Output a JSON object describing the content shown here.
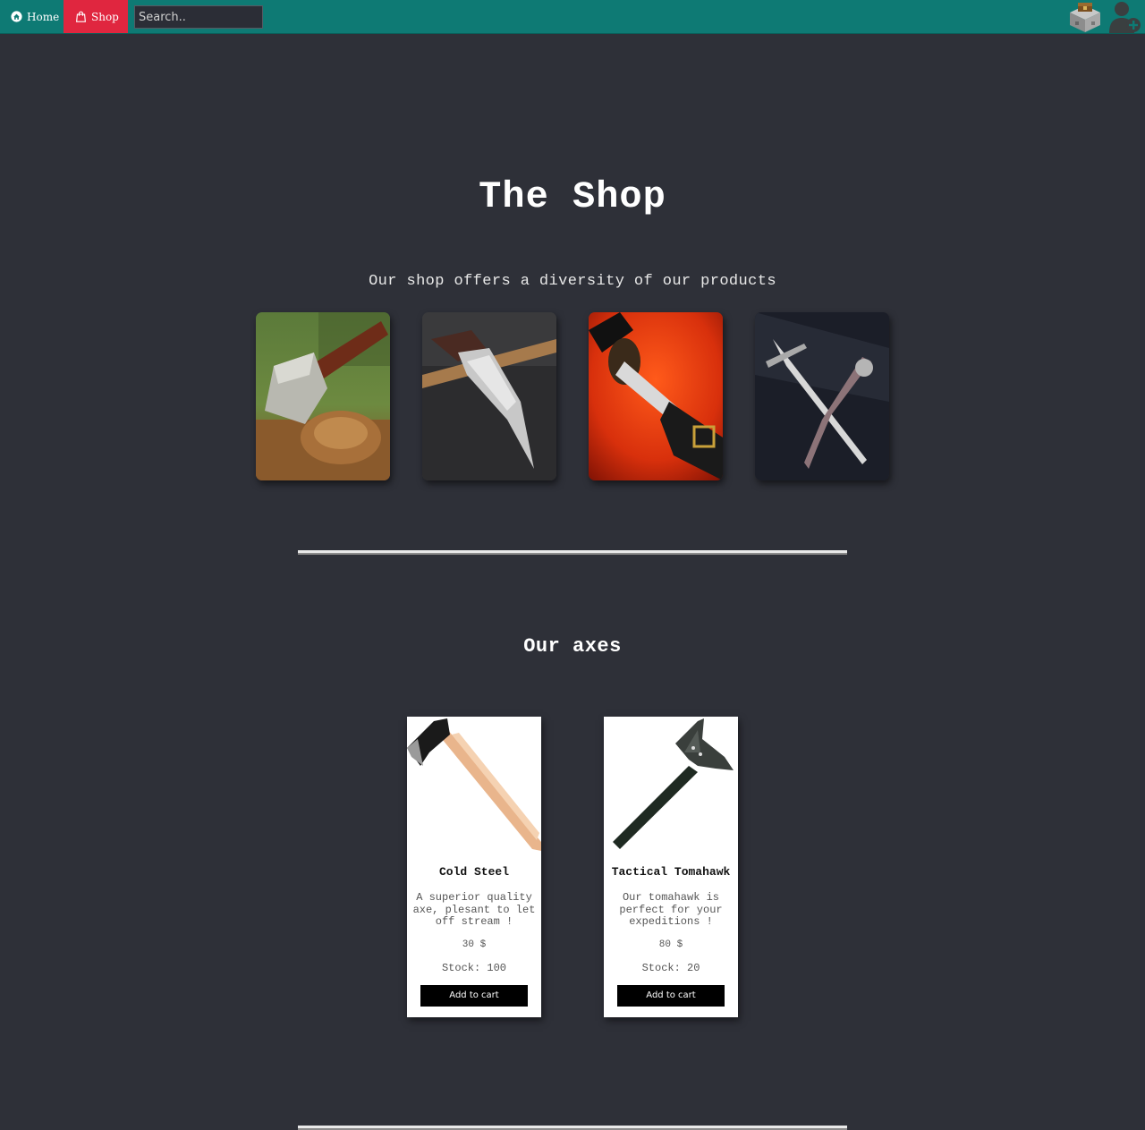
{
  "nav": {
    "home_label": "Home",
    "shop_label": "Shop",
    "search_placeholder": "Search..",
    "accent_color": "#0e7a74",
    "active_color": "#e0263f"
  },
  "header": {
    "title": "The Shop",
    "subtitle": "Our shop offers a diversity of our products"
  },
  "gallery": [
    {
      "icon": "axe-on-stump-photo"
    },
    {
      "icon": "folding-knife-photo"
    },
    {
      "icon": "katana-on-red-silk-photo"
    },
    {
      "icon": "dagger-pair-photo"
    }
  ],
  "axes_section": {
    "title": "Our axes",
    "products": [
      {
        "name": "Cold Steel",
        "description": "A superior quality axe, plesant to let off stream !",
        "price": "30 $",
        "stock": "Stock: 100",
        "button": "Add to cart",
        "icon": "felling-axe-image"
      },
      {
        "name": "Tactical Tomahawk",
        "description": "Our tomahawk is perfect for your expeditions !",
        "price": "80 $",
        "stock": "Stock: 20",
        "button": "Add to cart",
        "icon": "tomahawk-image"
      }
    ]
  }
}
